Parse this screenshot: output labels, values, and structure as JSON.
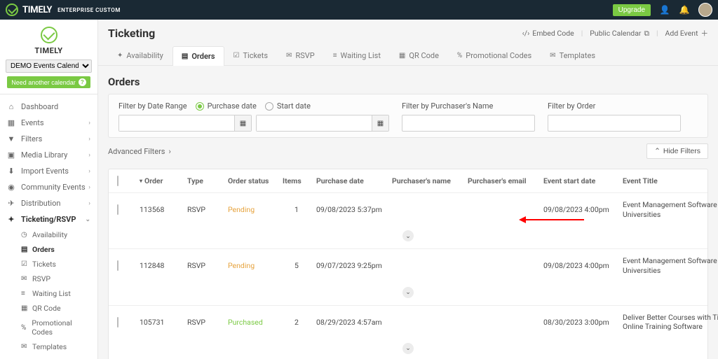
{
  "topbar": {
    "brand_name": "TIMELY",
    "brand_sub": "ENTERPRISE CUSTOM",
    "upgrade": "Upgrade"
  },
  "sidebar": {
    "brand": "TIMELY",
    "calendar_select": "DEMO Events Calendar (M...",
    "need_another": "Need another calendar",
    "items": [
      {
        "icon": "home-icon",
        "glyph": "⌂",
        "label": "Dashboard",
        "expandable": false
      },
      {
        "icon": "calendar-icon",
        "glyph": "▦",
        "label": "Events",
        "expandable": true
      },
      {
        "icon": "filter-icon",
        "glyph": "▼",
        "label": "Filters",
        "expandable": true
      },
      {
        "icon": "image-icon",
        "glyph": "▣",
        "label": "Media Library",
        "expandable": true
      },
      {
        "icon": "download-icon",
        "glyph": "⬇",
        "label": "Import Events",
        "expandable": true
      },
      {
        "icon": "globe-icon",
        "glyph": "◉",
        "label": "Community Events",
        "expandable": true
      },
      {
        "icon": "send-icon",
        "glyph": "✈",
        "label": "Distribution",
        "expandable": true
      },
      {
        "icon": "ticket-icon",
        "glyph": "✦",
        "label": "Ticketing/RSVP",
        "expandable": true,
        "active": true
      }
    ],
    "sub_items": [
      {
        "glyph": "◷",
        "label": "Availability"
      },
      {
        "glyph": "▤",
        "label": "Orders",
        "active": true
      },
      {
        "glyph": "☑",
        "label": "Tickets"
      },
      {
        "glyph": "✉",
        "label": "RSVP"
      },
      {
        "glyph": "≡",
        "label": "Waiting List"
      },
      {
        "glyph": "▦",
        "label": "QR Code"
      },
      {
        "glyph": "%",
        "label": "Promotional Codes"
      },
      {
        "glyph": "✉",
        "label": "Templates"
      }
    ]
  },
  "header": {
    "title": "Ticketing",
    "links": {
      "embed": "Embed Code",
      "public": "Public Calendar",
      "add_event": "Add Event"
    }
  },
  "tabs": [
    {
      "glyph": "✦",
      "label": "Availability"
    },
    {
      "glyph": "▤",
      "label": "Orders",
      "active": true
    },
    {
      "glyph": "☑",
      "label": "Tickets"
    },
    {
      "glyph": "✉",
      "label": "RSVP"
    },
    {
      "glyph": "≡",
      "label": "Waiting List"
    },
    {
      "glyph": "▦",
      "label": "QR Code"
    },
    {
      "glyph": "%",
      "label": "Promotional Codes"
    },
    {
      "glyph": "✉",
      "label": "Templates"
    }
  ],
  "orders": {
    "title": "Orders",
    "filters": {
      "date_label": "Filter by Date Range",
      "purchase_radio": "Purchase date",
      "start_radio": "Start date",
      "purchaser_label": "Filter by Purchaser's Name",
      "order_label": "Filter by Order",
      "advanced": "Advanced Filters",
      "hide": "Hide Filters"
    },
    "columns": {
      "order": "Order",
      "type": "Type",
      "status": "Order status",
      "items": "Items",
      "purchase_date": "Purchase date",
      "purchaser_name": "Purchaser's name",
      "purchaser_email": "Purchaser's email",
      "event_start": "Event start date",
      "event_title": "Event Title"
    },
    "rows": [
      {
        "id": "113568",
        "type": "RSVP",
        "status": "Pending",
        "status_class": "pending",
        "items": "1",
        "purchase_date": "09/08/2023 5:37pm",
        "event_start": "09/08/2023 4:00pm",
        "event_title": "Event Management Software for Universities",
        "annotate": true
      },
      {
        "id": "112848",
        "type": "RSVP",
        "status": "Pending",
        "status_class": "pending",
        "items": "5",
        "purchase_date": "09/07/2023 9:25pm",
        "event_start": "09/08/2023 4:00pm",
        "event_title": "Event Management Software for Universities"
      },
      {
        "id": "105731",
        "type": "RSVP",
        "status": "Purchased",
        "status_class": "purchased",
        "items": "2",
        "purchase_date": "08/29/2023 4:57am",
        "event_start": "08/30/2023 3:00pm",
        "event_title": "Deliver Better Courses with Timely Online Training Software"
      }
    ]
  }
}
